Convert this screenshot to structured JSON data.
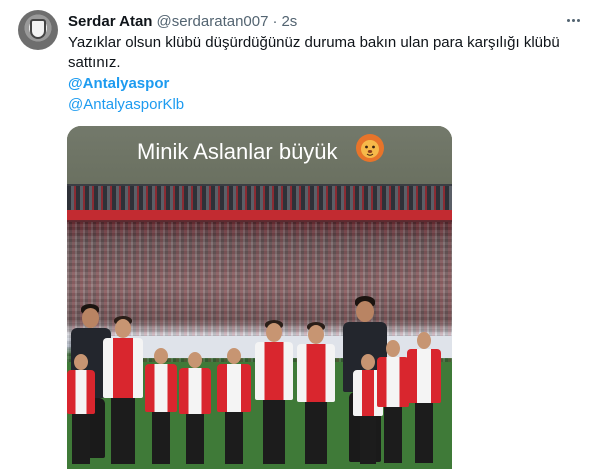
{
  "tweet": {
    "display_name": "Serdar Atan",
    "handle": "@serdaratan007",
    "separator": "·",
    "time": "2s",
    "text": "Yazıklar olsun klübü düşürdüğünüz duruma bakın ulan para karşılığı klübü sattınız.",
    "mentions": [
      "@Antalyaspor",
      "@AntalyasporKlb"
    ]
  },
  "media": {
    "caption": "Minik Aslanlar büyük",
    "caption_emoji": "lion-face-icon"
  },
  "icons": {
    "more": "more-options-icon",
    "avatar": "avatar"
  },
  "colors": {
    "text": "#0f1419",
    "secondary_text": "#536471",
    "link": "#1d9bf0",
    "kit_red": "#d9262e"
  }
}
